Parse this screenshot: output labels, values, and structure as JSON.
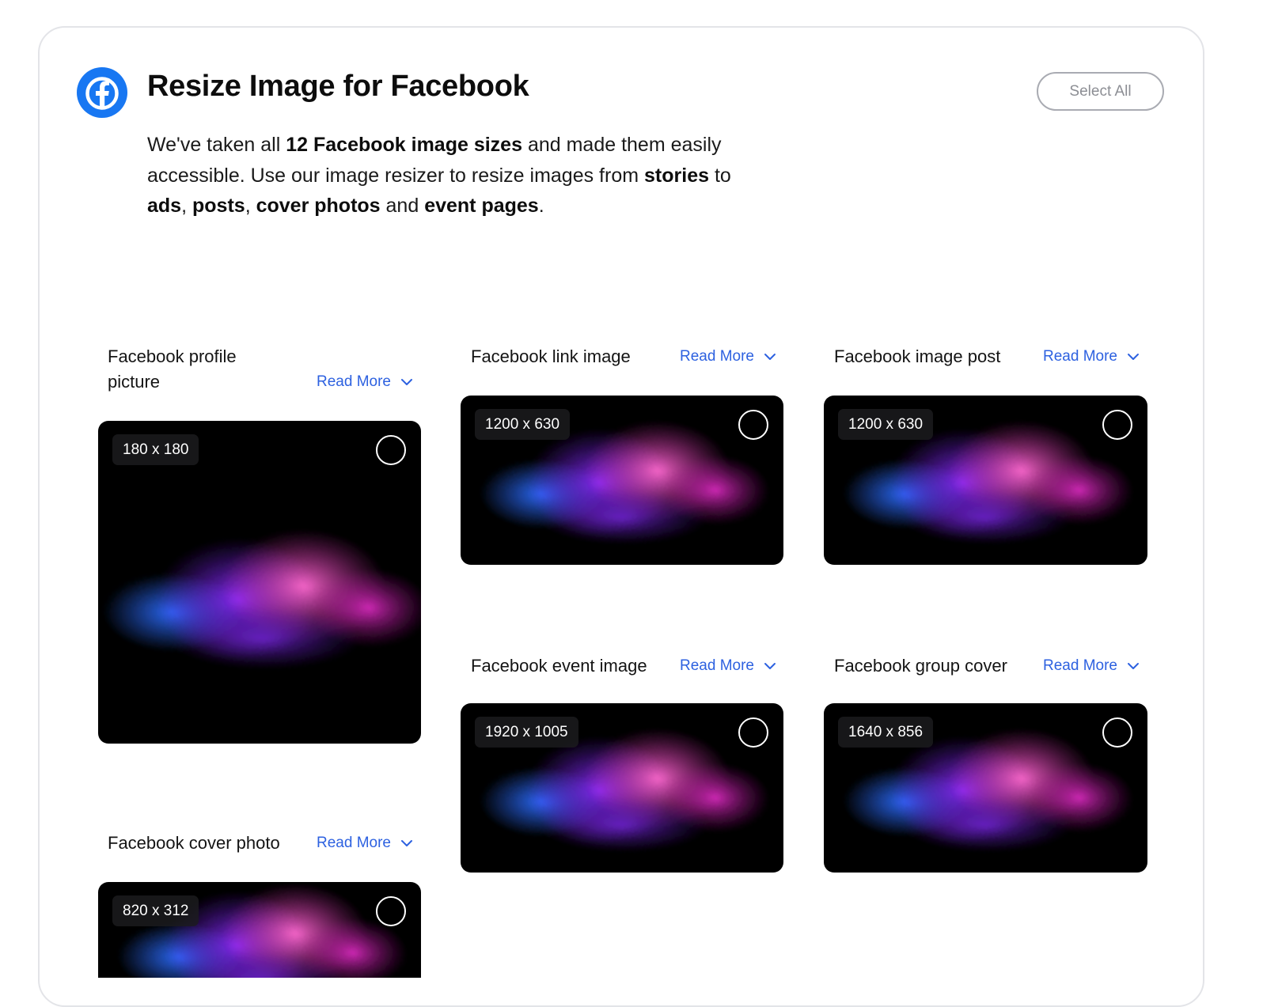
{
  "header": {
    "title": "Resize Image for Facebook",
    "select_all_label": "Select All",
    "logo_icon": "facebook-logo-icon",
    "brand_color": "#1877f2"
  },
  "description": {
    "t1": "We've taken all ",
    "b1": "12 Facebook image sizes",
    "t2": " and made them easily accessible. Use our image resizer to resize images from ",
    "b2": "stories",
    "t3": " to ",
    "b3": "ads",
    "t4": ", ",
    "b4": "posts",
    "t5": ", ",
    "b5": "cover photos",
    "t6": " and ",
    "b6": "event pages",
    "t7": "."
  },
  "read_more_label": "Read More",
  "accent_color": "#2d61e0",
  "cards": [
    {
      "title": "Facebook profile picture",
      "size": "180 x 180"
    },
    {
      "title": "Facebook link image",
      "size": "1200 x 630"
    },
    {
      "title": "Facebook image post",
      "size": "1200 x 630"
    },
    {
      "title": "Facebook event image",
      "size": "1920 x 1005"
    },
    {
      "title": "Facebook group cover",
      "size": "1640 x 856"
    },
    {
      "title": "Facebook cover photo",
      "size": "820 x 312"
    }
  ]
}
